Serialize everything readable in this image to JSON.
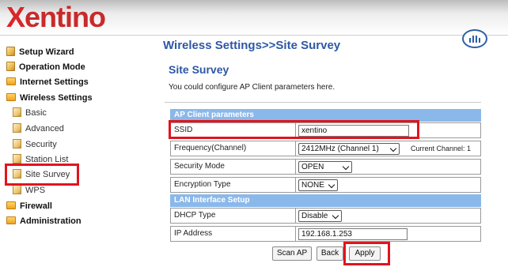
{
  "brand": {
    "logo_x": "X",
    "logo_rest": "entino"
  },
  "menu": {
    "items": [
      {
        "label": "Setup Wizard",
        "icon": "doc-icon"
      },
      {
        "label": "Operation Mode",
        "icon": "doc-icon"
      },
      {
        "label": "Internet Settings",
        "icon": "folder-icon"
      },
      {
        "label": "Wireless Settings",
        "icon": "folder-icon"
      },
      {
        "label": "Basic",
        "icon": "doc-icon"
      },
      {
        "label": "Advanced",
        "icon": "doc-icon"
      },
      {
        "label": "Security",
        "icon": "doc-icon"
      },
      {
        "label": "Station List",
        "icon": "doc-icon"
      },
      {
        "label": "Site Survey",
        "icon": "doc-icon"
      },
      {
        "label": "WPS",
        "icon": "doc-icon"
      },
      {
        "label": "Firewall",
        "icon": "folder-icon"
      },
      {
        "label": "Administration",
        "icon": "folder-icon"
      }
    ]
  },
  "main": {
    "breadcrumb_title": "Wireless Settings>>Site Survey",
    "page_title": "Site Survey",
    "description": "You could configure AP Client parameters here."
  },
  "ap_client": {
    "header": "AP Client parameters",
    "ssid_label": "SSID",
    "ssid_value": "xentino",
    "frequency_label": "Frequency(Channel)",
    "frequency_value": "2412MHz (Channel 1)",
    "current_channel": "Current Channel: 1",
    "security_label": "Security Mode",
    "security_value": "OPEN",
    "encryption_label": "Encryption Type",
    "encryption_value": "NONE"
  },
  "lan": {
    "header": "LAN Interface Setup",
    "dhcp_label": "DHCP Type",
    "dhcp_value": "Disable",
    "ip_label": "IP Address",
    "ip_value": "192.168.1.253"
  },
  "buttons": {
    "scan_ap": "Scan AP",
    "back": "Back",
    "apply": "Apply"
  },
  "colors": {
    "accent_blue": "#2d57a5",
    "section_header": "#8ab8ea",
    "highlight_red": "#e0141e",
    "logo_red": "#d9262a"
  }
}
